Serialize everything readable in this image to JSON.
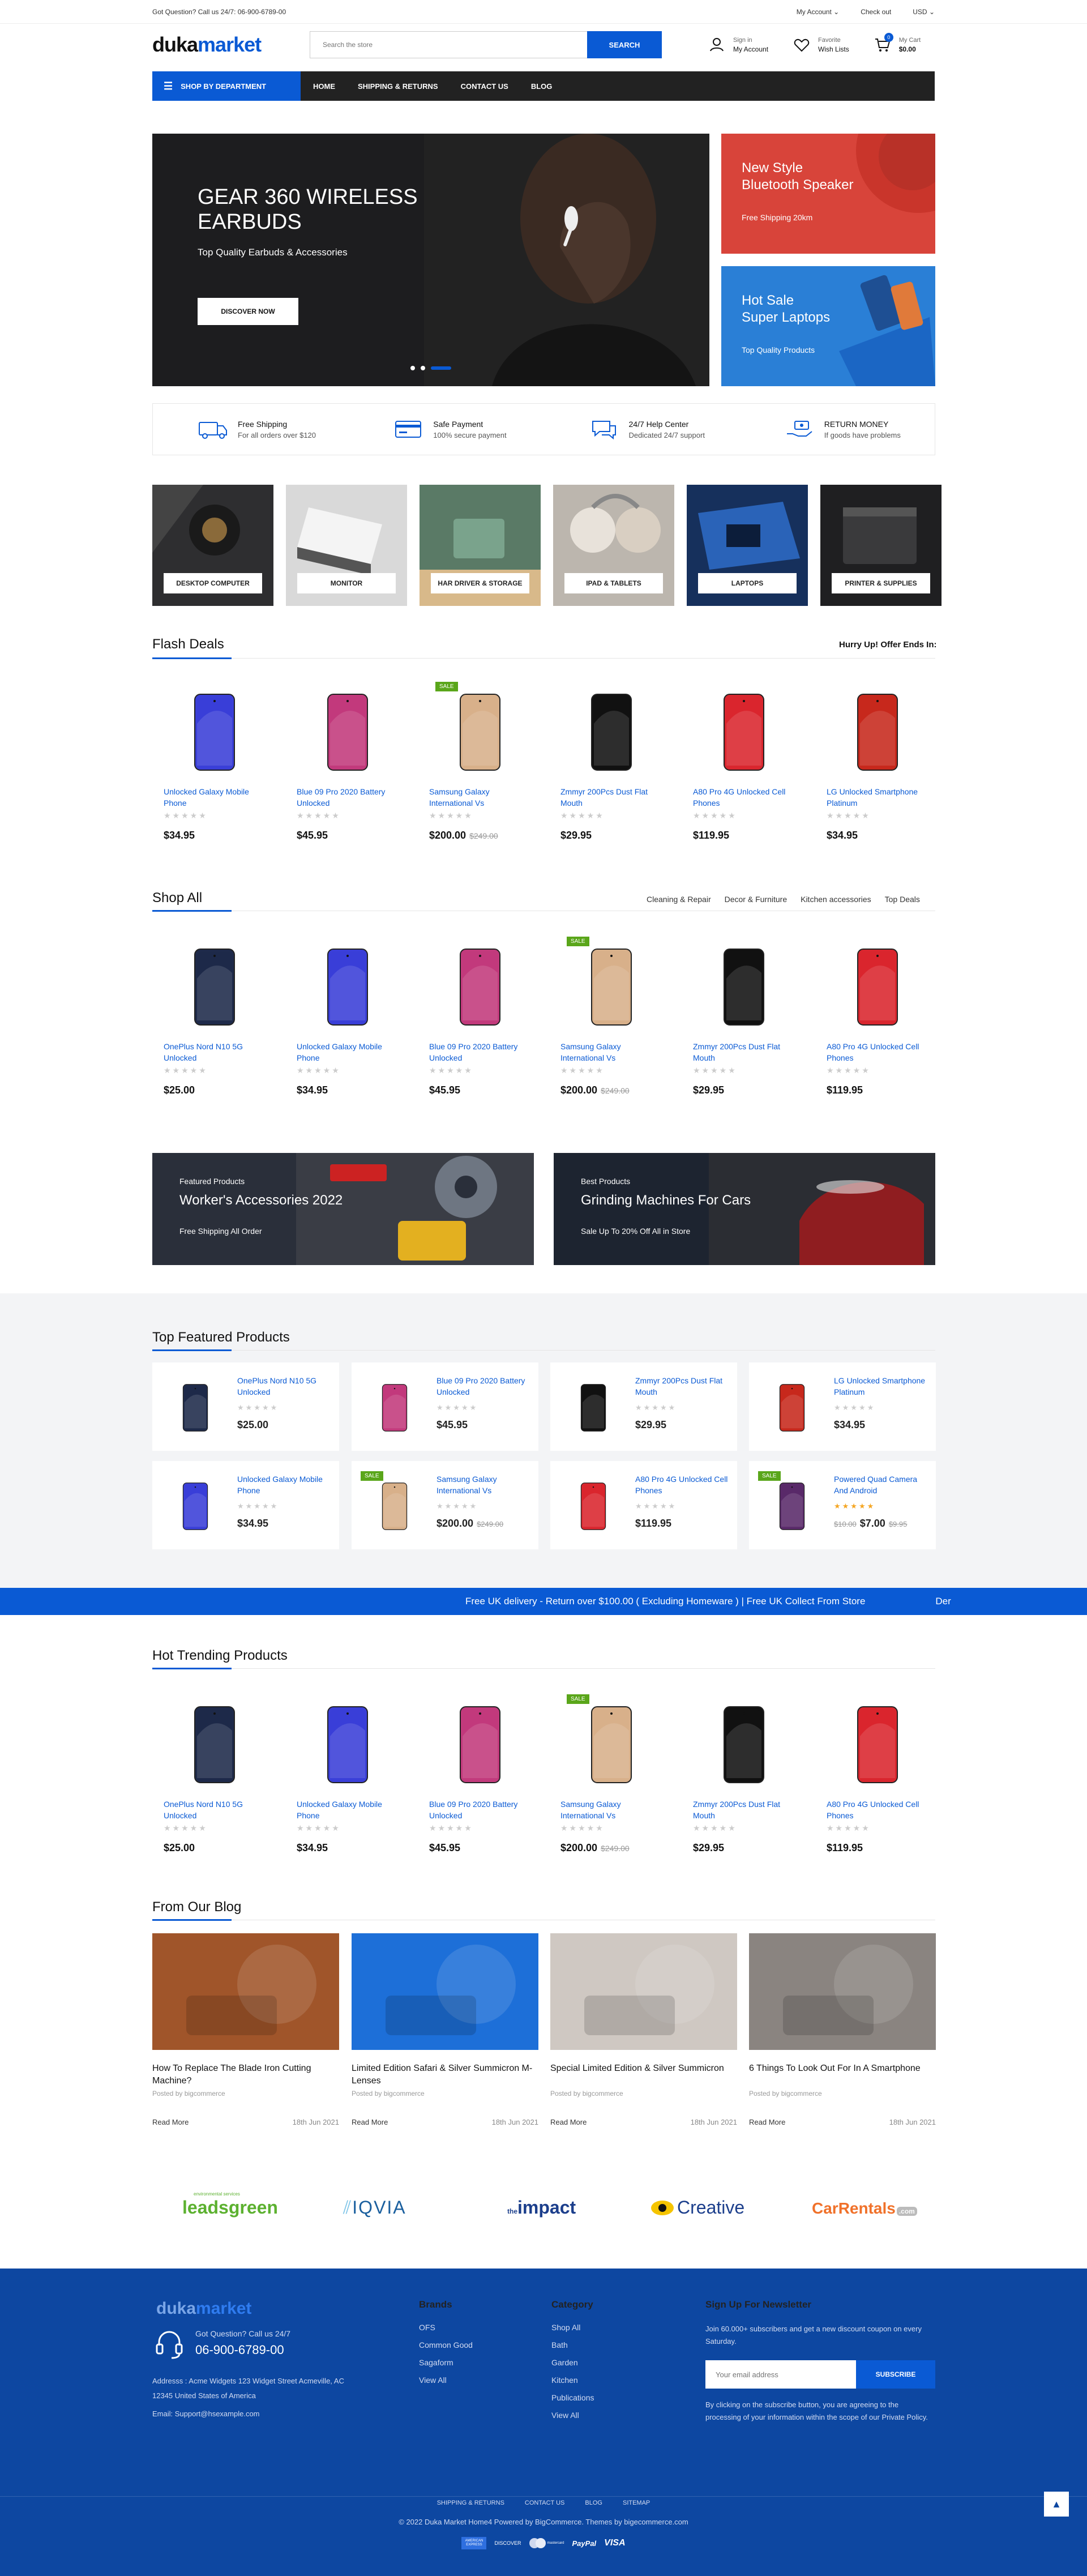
{
  "topbar": {
    "question": "Got Question? Call us 24/7: 06-900-6789-00",
    "my_account": "My Account",
    "check_out": "Check out",
    "currency": "USD"
  },
  "header": {
    "logo_a": "duka",
    "logo_b": "market",
    "search_placeholder": "Search the store",
    "search_btn": "SEARCH",
    "signin_sm": "Sign in",
    "signin_bg": "My Account",
    "fav_sm": "Favorite",
    "fav_bg": "Wish Lists",
    "cart_sm": "My Cart",
    "cart_total": "$0.00",
    "cart_count": "0"
  },
  "nav": {
    "dept": "SHOP BY DEPARTMENT",
    "links": [
      "HOME",
      "SHIPPING & RETURNS",
      "CONTACT US",
      "BLOG"
    ]
  },
  "hero": {
    "title": "GEAR 360 WIRELESS EARBUDS",
    "sub": "Top Quality Earbuds & Accessories",
    "btn": "DISCOVER NOW"
  },
  "side1": {
    "title": "New Style\nBluetooth Speaker",
    "sub": "Free Shipping 20km"
  },
  "side2": {
    "title": "Hot Sale\nSuper Laptops",
    "sub": "Top Quality Products"
  },
  "features": [
    {
      "t1": "Free Shipping",
      "t2": "For all orders over $120"
    },
    {
      "t1": "Safe Payment",
      "t2": "100% secure payment"
    },
    {
      "t1": "24/7 Help Center",
      "t2": "Dedicated 24/7 support"
    },
    {
      "t1": "RETURN MONEY",
      "t2": "If goods have problems"
    }
  ],
  "categories": [
    "DESKTOP COMPUTER",
    "MONITOR",
    "HAR DRIVER & STORAGE",
    "IPAD & TABLETS",
    "LAPTOPS",
    "PRINTER & SUPPLIES"
  ],
  "flash": {
    "title": "Flash Deals",
    "hurry": "Hurry Up! Offer Ends In:"
  },
  "flash_products": [
    {
      "name": "Unlocked Galaxy Mobile Phone",
      "price": "$34.95",
      "old": "",
      "sale": "",
      "color": "#3a3fd8"
    },
    {
      "name": "Blue 09 Pro 2020 Battery Unlocked",
      "price": "$45.95",
      "old": "",
      "sale": "",
      "color": "#c23a7c"
    },
    {
      "name": "Samsung Galaxy International Vs",
      "price": "$200.00",
      "old": "$249.00",
      "sale": "SALE",
      "color": "#d8b08a"
    },
    {
      "name": "Zmmyr 200Pcs Dust Flat Mouth",
      "price": "$29.95",
      "old": "",
      "sale": "",
      "color": "#111"
    },
    {
      "name": "A80 Pro 4G Unlocked Cell Phones",
      "price": "$119.95",
      "old": "",
      "sale": "",
      "color": "#d9262e"
    },
    {
      "name": "LG Unlocked Smartphone Platinum",
      "price": "$34.95",
      "old": "",
      "sale": "",
      "color": "#c7281c"
    }
  ],
  "shop": {
    "title": "Shop All",
    "tabs": [
      "Cleaning & Repair",
      "Decor & Furniture",
      "Kitchen accessories",
      "Top Deals"
    ]
  },
  "shop_products": [
    {
      "name": "OnePlus Nord N10 5G Unlocked",
      "price": "$25.00",
      "old": "",
      "sale": "",
      "color": "#1e2a4a"
    },
    {
      "name": "Unlocked Galaxy Mobile Phone",
      "price": "$34.95",
      "old": "",
      "sale": "",
      "color": "#3a3fd8"
    },
    {
      "name": "Blue 09 Pro 2020 Battery Unlocked",
      "price": "$45.95",
      "old": "",
      "sale": "",
      "color": "#c23a7c"
    },
    {
      "name": "Samsung Galaxy International Vs",
      "price": "$200.00",
      "old": "$249.00",
      "sale": "SALE",
      "color": "#d8b08a"
    },
    {
      "name": "Zmmyr 200Pcs Dust Flat Mouth",
      "price": "$29.95",
      "old": "",
      "sale": "",
      "color": "#111"
    },
    {
      "name": "A80 Pro 4G Unlocked Cell Phones",
      "price": "$119.95",
      "old": "",
      "sale": "",
      "color": "#d9262e"
    }
  ],
  "promo1": {
    "a": "Featured Products",
    "b": "Worker's Accessories 2022",
    "c": "Free Shipping All Order"
  },
  "promo2": {
    "a": "Best Products",
    "b": "Grinding Machines For Cars",
    "c": "Sale Up To 20% Off  All in Store"
  },
  "featured": {
    "title": "Top Featured Products"
  },
  "featured_products": [
    {
      "name": "OnePlus Nord N10 5G Unlocked",
      "price": "$25.00",
      "old": "",
      "sale": "",
      "color": "#1e2a4a",
      "stars": "★★★★★",
      "rated": false
    },
    {
      "name": "Blue 09 Pro 2020 Battery Unlocked",
      "price": "$45.95",
      "old": "",
      "sale": "",
      "color": "#c23a7c",
      "stars": "★★★★★",
      "rated": false
    },
    {
      "name": "Zmmyr 200Pcs Dust Flat Mouth",
      "price": "$29.95",
      "old": "",
      "sale": "",
      "color": "#111",
      "stars": "★★★★★",
      "rated": false
    },
    {
      "name": "LG Unlocked Smartphone Platinum",
      "price": "$34.95",
      "old": "",
      "sale": "",
      "color": "#c7281c",
      "stars": "★★★★★",
      "rated": false
    },
    {
      "name": "Unlocked Galaxy Mobile Phone",
      "price": "$34.95",
      "old": "",
      "sale": "",
      "color": "#3a3fd8",
      "stars": "★★★★★",
      "rated": false
    },
    {
      "name": "Samsung Galaxy International Vs",
      "price": "$200.00",
      "old": "$249.00",
      "sale": "SALE",
      "color": "#d8b08a",
      "stars": "★★★★★",
      "rated": false
    },
    {
      "name": "A80 Pro 4G Unlocked Cell Phones",
      "price": "$119.95",
      "old": "",
      "sale": "",
      "color": "#d9262e",
      "stars": "★★★★★",
      "rated": false
    },
    {
      "name": "Powered Quad Camera And Android",
      "price": "$7.00",
      "old": "$9.95",
      "pre": "$10.00",
      "sale": "SALE",
      "color": "#5a2a6a",
      "stars": "★★★★★",
      "rated": true
    }
  ],
  "marquee": "Free UK delivery - Return over $100.00 ( Excluding Homeware ) | Free UK Collect From Store",
  "marquee_tail": "Der",
  "trending": {
    "title": "Hot Trending Products"
  },
  "trending_products": [
    {
      "name": "OnePlus Nord N10 5G Unlocked",
      "price": "$25.00",
      "old": "",
      "sale": "",
      "color": "#1e2a4a"
    },
    {
      "name": "Unlocked Galaxy Mobile Phone",
      "price": "$34.95",
      "old": "",
      "sale": "",
      "color": "#3a3fd8"
    },
    {
      "name": "Blue 09 Pro 2020 Battery Unlocked",
      "price": "$45.95",
      "old": "",
      "sale": "",
      "color": "#c23a7c"
    },
    {
      "name": "Samsung Galaxy International Vs",
      "price": "$200.00",
      "old": "$249.00",
      "sale": "SALE",
      "color": "#d8b08a"
    },
    {
      "name": "Zmmyr 200Pcs Dust Flat Mouth",
      "price": "$29.95",
      "old": "",
      "sale": "",
      "color": "#111"
    },
    {
      "name": "A80 Pro 4G Unlocked Cell Phones",
      "price": "$119.95",
      "old": "",
      "sale": "",
      "color": "#d9262e"
    }
  ],
  "blog": {
    "title": "From Our Blog",
    "read_more": "Read More",
    "posts": [
      {
        "title": "How To Replace The Blade Iron Cutting Machine?",
        "by": "Posted by bigcommerce",
        "date": "18th Jun 2021",
        "bg": "#a0552a"
      },
      {
        "title": "Limited Edition Safari & Silver Summicron M-Lenses",
        "by": "Posted by bigcommerce",
        "date": "18th Jun 2021",
        "bg": "#1d6fd8"
      },
      {
        "title": "Special Limited Edition & Silver Summicron",
        "by": "Posted by bigcommerce",
        "date": "18th Jun 2021",
        "bg": "#cfc8c2"
      },
      {
        "title": "6 Things To Look Out For In A Smartphone",
        "by": "Posted by bigcommerce",
        "date": "18th Jun 2021",
        "bg": "#8a8480"
      }
    ]
  },
  "brands": [
    "leadsgreen",
    "IQVIA",
    "impact",
    "Creative",
    "CarRentals"
  ],
  "brand_impact_prefix": "the",
  "brand_leads_tag": "environmental services",
  "brand_car_suffix": ".com",
  "footer": {
    "logo_a": "duka",
    "logo_b": "market",
    "help": "Got Question? Call us 24/7",
    "phone": "06-900-6789-00",
    "addr1": "Addresss : Acme Widgets 123 Widget Street Acmeville, AC",
    "addr2": "12345 United States of America",
    "email": "Email: Support@hsexample.com",
    "brands_title": "Brands",
    "brands": [
      "OFS",
      "Common Good",
      "Sagaform",
      "View All"
    ],
    "cat_title": "Category",
    "cats": [
      "Shop All",
      "Bath",
      "Garden",
      "Kitchen",
      "Publications",
      "View All"
    ],
    "news_title": "Sign Up For Newsletter",
    "news_text": "Join 60.000+ subscribers and get a new discount coupon on every Saturday.",
    "email_placeholder": "Your email address",
    "subscribe": "SUBSCRIBE",
    "news_note": "By clicking on the subscribe button, you are agreeing to the processing of your information within the scope of our Private Policy.",
    "bottom_links": [
      "SHIPPING & RETURNS",
      "CONTACT US",
      "BLOG",
      "SITEMAP"
    ],
    "copyright": "© 2022 Duka Market Home4 Powered by BigCommerce. Themes by bigecommerce.com",
    "payments": [
      "AMERICAN EXPRESS",
      "DISCOVER",
      "mastercard",
      "PayPal",
      "VISA"
    ]
  }
}
